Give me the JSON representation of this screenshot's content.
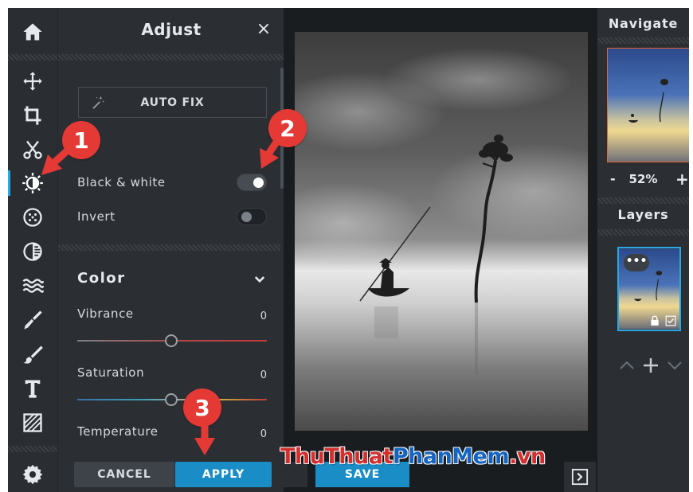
{
  "adjust_panel": {
    "title": "Adjust",
    "close_label": "×",
    "auto_fix_label": "AUTO FIX",
    "black_white": {
      "label": "Black & white",
      "enabled": true
    },
    "invert": {
      "label": "Invert",
      "enabled": false
    },
    "color_section": {
      "heading": "Color",
      "sliders": [
        {
          "label": "Vibrance",
          "value": "0"
        },
        {
          "label": "Saturation",
          "value": "0"
        },
        {
          "label": "Temperature",
          "value": "0"
        }
      ]
    },
    "cancel_label": "CANCEL",
    "apply_label": "APPLY"
  },
  "canvas": {
    "save_label": "SAVE"
  },
  "navigate": {
    "title": "Navigate",
    "zoom_minus": "-",
    "zoom_value": "52%",
    "zoom_plus": "+"
  },
  "layers": {
    "title": "Layers",
    "menu_label": "•••"
  },
  "callouts": [
    "1",
    "2",
    "3"
  ],
  "watermark": {
    "part1": "ThuThuat",
    "part2": "PhanMem",
    "part3": ".vn"
  },
  "toolbar_icons": [
    "home-icon",
    "move-icon",
    "crop-icon",
    "cut-icon",
    "adjust-icon",
    "effects-icon",
    "filters-icon",
    "waves-icon",
    "brush-icon",
    "draw-icon",
    "text-icon",
    "texture-icon",
    "settings-icon"
  ],
  "colors": {
    "accent": "#1a8dc7",
    "active_indicator": "#29a9e0",
    "callout": "#e53935",
    "nav_border": "#e2652e"
  }
}
